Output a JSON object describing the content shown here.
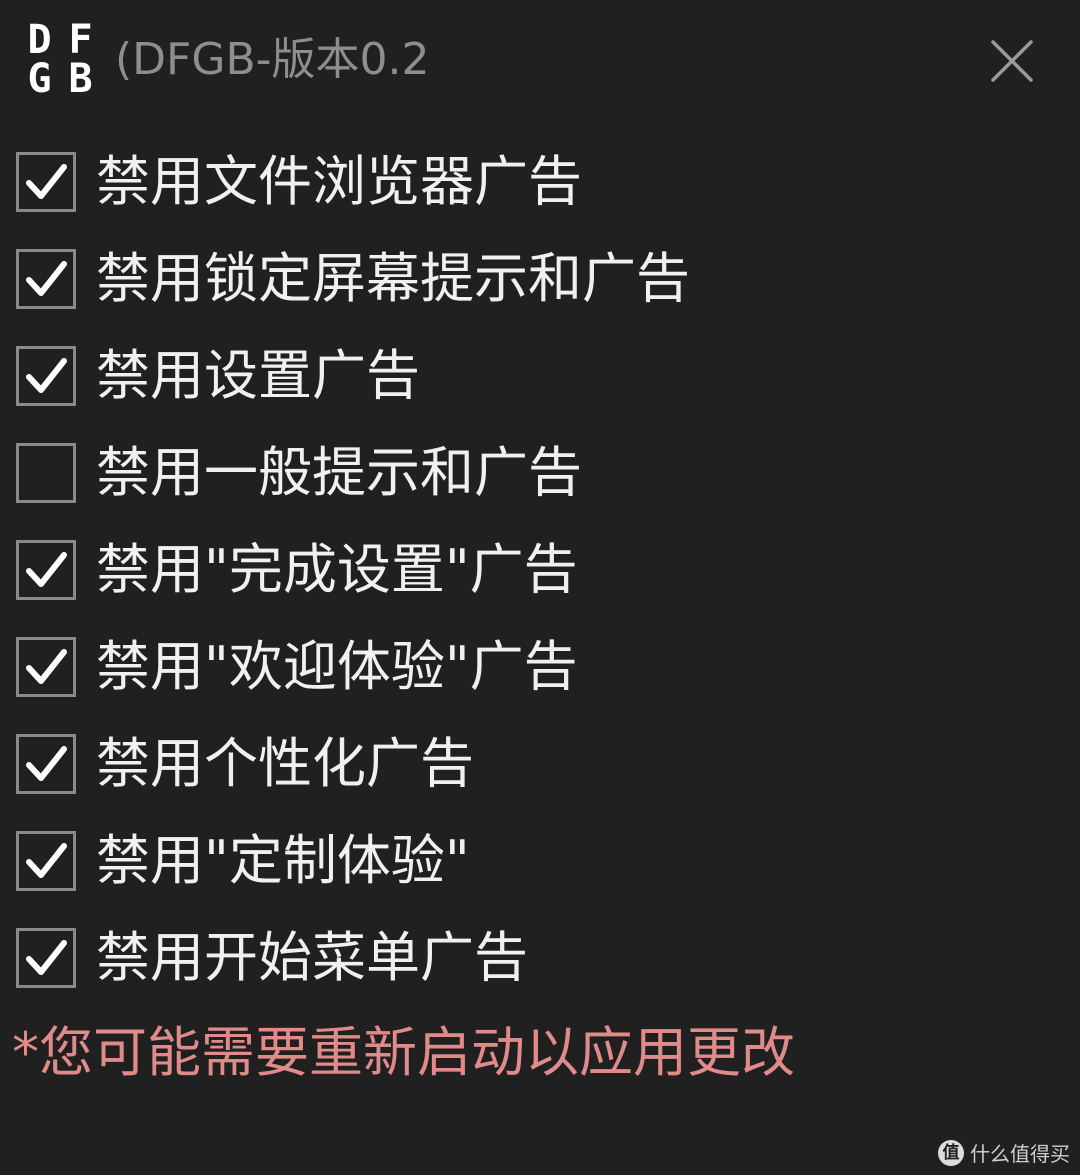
{
  "header": {
    "logo": {
      "letters": [
        "D",
        "F",
        "G",
        "B"
      ]
    },
    "title": "(DFGB-版本0.2",
    "close_icon": "close-icon"
  },
  "options": [
    {
      "label": "禁用文件浏览器广告",
      "checked": true
    },
    {
      "label": "禁用锁定屏幕提示和广告",
      "checked": true
    },
    {
      "label": "禁用设置广告",
      "checked": true
    },
    {
      "label": "禁用一般提示和广告",
      "checked": false
    },
    {
      "label": "禁用\"完成设置\"广告",
      "checked": true
    },
    {
      "label": "禁用\"欢迎体验\"广告",
      "checked": true
    },
    {
      "label": "禁用个性化广告",
      "checked": true
    },
    {
      "label": "禁用\"定制体验\"",
      "checked": true
    },
    {
      "label": "禁用开始菜单广告",
      "checked": true
    }
  ],
  "notice": "*您可能需要重新启动以应用更改",
  "watermark": {
    "badge": "值",
    "text": "什么值得买"
  },
  "colors": {
    "background": "#202020",
    "text": "#f0f0f0",
    "title": "#8e8e8e",
    "notice": "#e08a8a",
    "checkbox_border": "#8a8a8a",
    "checkmark": "#ffffff"
  }
}
